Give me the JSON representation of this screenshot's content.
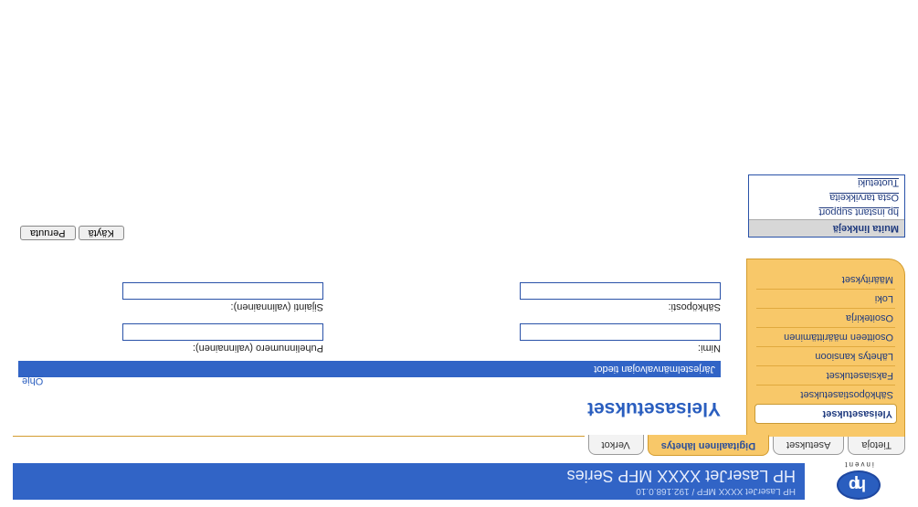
{
  "header": {
    "logo_text": "hp",
    "logo_sub": "invent",
    "subtitle": "HP LaserJet XXXX MFP / 192.168.0.10",
    "title": "HP LaserJet XXXX MFP Series"
  },
  "tabs": [
    {
      "label": "Tietoja",
      "active": false
    },
    {
      "label": "Asetukset",
      "active": false
    },
    {
      "label": "Digitaalinen lähetys",
      "active": true
    },
    {
      "label": "Verkot",
      "active": false
    }
  ],
  "sidebar": {
    "items": [
      {
        "label": "Yleisasetukset",
        "selected": true
      },
      {
        "label": "Sähköpostiasetukset",
        "selected": false
      },
      {
        "label": "Faksiasetukset",
        "selected": false
      },
      {
        "label": "Lähetys kansioon",
        "selected": false
      },
      {
        "label": "Osoitteen määrittäminen",
        "selected": false
      },
      {
        "label": "Osoitekirja",
        "selected": false
      },
      {
        "label": "Loki",
        "selected": false
      },
      {
        "label": "Määritykset",
        "selected": false
      }
    ]
  },
  "other_links": {
    "heading": "Muita linkkejä",
    "items": [
      "hp instant support",
      "Osta tarvikkeita",
      "Tuotetuki"
    ]
  },
  "main": {
    "page_title": "Yleisasetukset",
    "help": "Ohje",
    "section_title": "Järjestelmänvalvojan tiedot",
    "fields": {
      "name": {
        "label": "Nimi:",
        "value": ""
      },
      "phone": {
        "label": "Puhelinnumero (valinnainen):",
        "value": ""
      },
      "email": {
        "label": "Sähköposti:",
        "value": ""
      },
      "location": {
        "label": "Sijainti (valinnainen):",
        "value": ""
      }
    },
    "buttons": {
      "apply": "Käytä",
      "cancel": "Peruuta"
    }
  }
}
